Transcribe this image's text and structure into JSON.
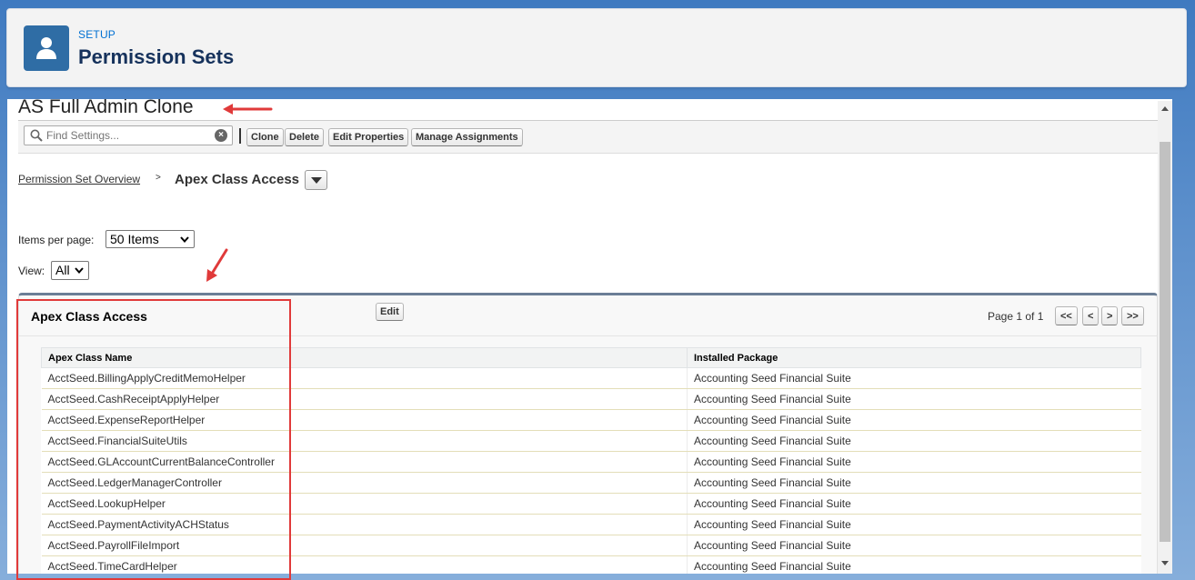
{
  "header": {
    "setup_label": "SETUP",
    "title": "Permission Sets",
    "icon": "user-icon",
    "accent": "#2f6da5"
  },
  "record": {
    "title": "AS Full Admin Clone"
  },
  "toolbar": {
    "search_placeholder": "Find Settings...",
    "clone_label": "Clone",
    "delete_label": "Delete",
    "edit_properties_label": "Edit Properties",
    "manage_assignments_label": "Manage Assignments"
  },
  "breadcrumb": {
    "overview_link": "Permission Set Overview",
    "separator": ">",
    "current": "Apex Class Access"
  },
  "filters": {
    "items_per_page_label": "Items per page:",
    "items_per_page_value": "50 Items",
    "view_label": "View:",
    "view_value": "All"
  },
  "section": {
    "title": "Apex Class Access",
    "edit_label": "Edit",
    "pager_text": "Page 1 of 1",
    "first_label": "<<",
    "prev_label": "<",
    "next_label": ">",
    "last_label": ">>"
  },
  "table": {
    "columns": [
      "Apex Class Name",
      "Installed Package"
    ],
    "rows": [
      [
        "AcctSeed.BillingApplyCreditMemoHelper",
        "Accounting Seed Financial Suite"
      ],
      [
        "AcctSeed.CashReceiptApplyHelper",
        "Accounting Seed Financial Suite"
      ],
      [
        "AcctSeed.ExpenseReportHelper",
        "Accounting Seed Financial Suite"
      ],
      [
        "AcctSeed.FinancialSuiteUtils",
        "Accounting Seed Financial Suite"
      ],
      [
        "AcctSeed.GLAccountCurrentBalanceController",
        "Accounting Seed Financial Suite"
      ],
      [
        "AcctSeed.LedgerManagerController",
        "Accounting Seed Financial Suite"
      ],
      [
        "AcctSeed.LookupHelper",
        "Accounting Seed Financial Suite"
      ],
      [
        "AcctSeed.PaymentActivityACHStatus",
        "Accounting Seed Financial Suite"
      ],
      [
        "AcctSeed.PayrollFileImport",
        "Accounting Seed Financial Suite"
      ],
      [
        "AcctSeed.TimeCardHelper",
        "Accounting Seed Financial Suite"
      ]
    ]
  },
  "annotation": {
    "color": "#e03a3a"
  }
}
